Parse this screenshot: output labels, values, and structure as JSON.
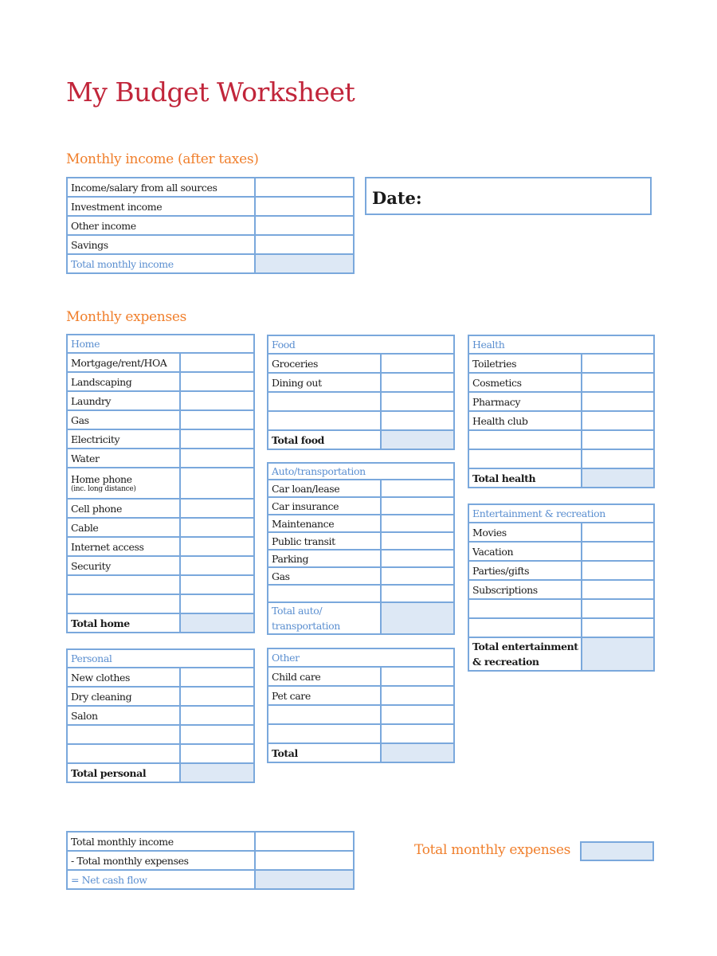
{
  "title": "My Budget Worksheet",
  "income": {
    "heading": "Monthly income (after taxes)",
    "rows": [
      {
        "label": "Income/salary from all sources",
        "value": ""
      },
      {
        "label": "Investment income",
        "value": ""
      },
      {
        "label": "Other income",
        "value": ""
      },
      {
        "label": "Savings",
        "value": ""
      }
    ],
    "total_label": "Total monthly income",
    "total_value": ""
  },
  "date": {
    "label": "Date:",
    "value": ""
  },
  "expenses": {
    "heading": "Monthly expenses",
    "home": {
      "title": "Home",
      "rows": [
        "Mortgage/rent/HOA",
        "Landscaping",
        "Laundry",
        "Gas",
        "Electricity",
        "Water",
        "Home phone",
        "Cell phone",
        "Cable",
        "Internet access",
        "Security",
        "",
        ""
      ],
      "home_phone_note": "(inc. long distance)",
      "total_label": "Total home"
    },
    "personal": {
      "title": "Personal",
      "rows": [
        "New clothes",
        "Dry cleaning",
        "Salon",
        "",
        ""
      ],
      "total_label": "Total personal"
    },
    "food": {
      "title": "Food",
      "rows": [
        "Groceries",
        "Dining out",
        "",
        ""
      ],
      "total_label": "Total food"
    },
    "auto": {
      "title": "Auto/transportation",
      "rows": [
        "Car loan/lease",
        "Car insurance",
        "Maintenance",
        "Public transit",
        "Parking",
        "Gas",
        ""
      ],
      "total_label_1": "Total auto/",
      "total_label_2": "transportation"
    },
    "other": {
      "title": "Other",
      "rows": [
        "Child care",
        "Pet care",
        "",
        ""
      ],
      "total_label": "Total"
    },
    "health": {
      "title": "Health",
      "rows": [
        "Toiletries",
        "Cosmetics",
        "Pharmacy",
        "Health club",
        "",
        ""
      ],
      "total_label": "Total health"
    },
    "entertainment": {
      "title": "Entertainment & recreation",
      "rows": [
        "Movies",
        "Vacation",
        "Parties/gifts",
        "Subscriptions",
        "",
        ""
      ],
      "total_label_1": "Total entertainment",
      "total_label_2": "& recreation"
    }
  },
  "summary": {
    "rows": [
      {
        "label": "Total monthly income",
        "value": ""
      },
      {
        "label": "- Total monthly expenses",
        "value": ""
      }
    ],
    "net_label": "= Net cash flow",
    "net_value": ""
  },
  "total_monthly_expenses": {
    "label": "Total monthly expenses",
    "value": ""
  },
  "colors": {
    "title": "#c1253a",
    "section_heading": "#f07f2c",
    "border": "#7aa8dc",
    "table_heading": "#5b8fd0",
    "total_fill": "#dde8f5"
  }
}
